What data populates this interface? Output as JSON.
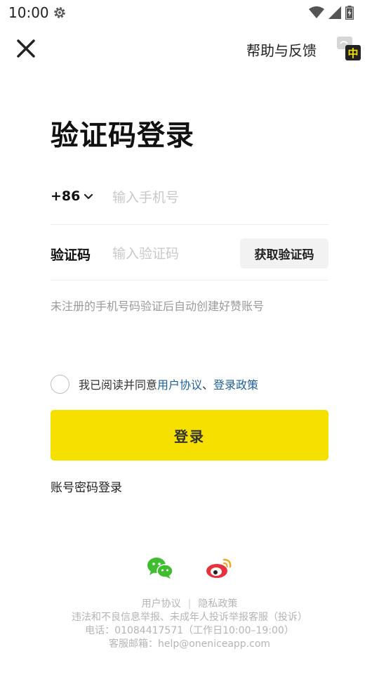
{
  "status_bar": {
    "time": "10:00",
    "icons": [
      "settings-icon",
      "wifi-icon",
      "signal-icon",
      "battery-charging-icon"
    ]
  },
  "header": {
    "close_icon": "close-icon",
    "help_label": "帮助与反馈",
    "translate_badge": "中"
  },
  "title": "验证码登录",
  "phone": {
    "country_code": "+86",
    "placeholder": "输入手机号",
    "value": ""
  },
  "code": {
    "label": "验证码",
    "placeholder": "输入验证码",
    "value": "",
    "get_code_button": "获取验证码"
  },
  "hint": "未注册的手机号码验证后自动创建好赞账号",
  "agreement": {
    "checked": false,
    "prefix": "我已阅读并同意",
    "user_agreement": "用户协议",
    "separator": "、",
    "login_policy": "登录政策"
  },
  "login_button": "登录",
  "password_login_link": "账号密码登录",
  "third_party": {
    "icons": [
      "wechat-icon",
      "weibo-icon"
    ]
  },
  "footer": {
    "user_agreement": "用户协议",
    "divider": "|",
    "privacy_policy": "隐私政策",
    "report_line": "违法和不良信息举报、未成年人投诉举报客服（投诉）",
    "phone_line": "电话：01084417571（工作日10:00–19:00）",
    "email_line": "客服邮箱：help@oneniceapp.com"
  },
  "colors": {
    "accent_yellow": "#f5e000",
    "link_blue": "#1e5f9c",
    "wechat_green": "#3fbd2e",
    "weibo_red": "#e6323e"
  }
}
